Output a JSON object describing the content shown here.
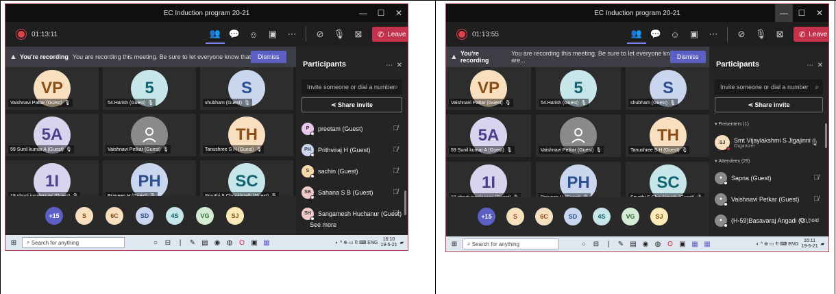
{
  "left": {
    "window_title": "EC Induction program 20-21",
    "timer": "01:13:11",
    "leave_label": "Leave",
    "banner": {
      "bold": "You're recording",
      "text": "You are recording this meeting. Be sure to let everyone know that they are...",
      "dismiss": "Dismiss"
    },
    "tiles": [
      {
        "initials": "VP",
        "name": "Vaishnavi Pattar (Guest)",
        "bg": "#f7dfc0",
        "fg": "#8a4f16"
      },
      {
        "initials": "5",
        "name": "54.Harish (Guest)",
        "bg": "#c7e6ea",
        "fg": "#12646f"
      },
      {
        "initials": "S",
        "name": "shubham (Guest)",
        "bg": "#c9d6ee",
        "fg": "#2b4f8f"
      },
      {
        "initials": "5A",
        "name": "59 Sunil kumar A (Guest)",
        "bg": "#d8d4ee",
        "fg": "#4a3f8a"
      },
      {
        "initials": "",
        "name": "Vaishnavi Petkar (Guest)",
        "bg": "#8a8a8a",
        "fg": "#ffffff"
      },
      {
        "initials": "TH",
        "name": "Tanushree S H (Guest)",
        "bg": "#f7dfc0",
        "fg": "#8a4f16"
      },
      {
        "initials": "1I",
        "name": "19 shruti ingaleswar (Guest)",
        "bg": "#d8d4ee",
        "fg": "#4a3f8a"
      },
      {
        "initials": "PH",
        "name": "Praveen H (Guest)",
        "bg": "#c9d6ee",
        "fg": "#2b4f8f"
      },
      {
        "initials": "SC",
        "name": "Spurthi S Choukimath (Guest)",
        "bg": "#c7e6ea",
        "fg": "#12646f"
      }
    ],
    "bottom_avatars": [
      {
        "label": "+15",
        "bg": "#5c5fc4",
        "fg": "#ffffff"
      },
      {
        "label": "S",
        "bg": "#f7dfc0",
        "fg": "#8a4f16"
      },
      {
        "label": "6C",
        "bg": "#f7dfc0",
        "fg": "#8a4f16"
      },
      {
        "label": "SD",
        "bg": "#c9d6ee",
        "fg": "#2b4f8f"
      },
      {
        "label": "4S",
        "bg": "#c7e6ea",
        "fg": "#12646f"
      },
      {
        "label": "VG",
        "bg": "#d4ecd4",
        "fg": "#2f6b2f"
      },
      {
        "label": "SJ",
        "bg": "#fbe9b8",
        "fg": "#7a5a10"
      }
    ],
    "panel": {
      "title": "Participants",
      "invite_placeholder": "Invite someone or dial a number",
      "share": "Share invite",
      "people": [
        {
          "initials": "P",
          "name": "preetam (Guest)",
          "bg": "#e8c8e8"
        },
        {
          "initials": "PH",
          "name": "Prithviraj H (Guest)",
          "bg": "#c9d6ee"
        },
        {
          "initials": "S",
          "name": "sachin (Guest)",
          "bg": "#f7d8a8"
        },
        {
          "initials": "SB",
          "name": "Sahana S B (Guest)",
          "bg": "#f0c8c8"
        },
        {
          "initials": "SH",
          "name": "Sangamesh Huchanur (Guest)",
          "bg": "#f0c8c8"
        }
      ],
      "see_more": "See more"
    },
    "taskbar": {
      "search": "Search for anything",
      "lang": "ENG",
      "time": "16:10",
      "date": "19-5-21"
    }
  },
  "right": {
    "window_title": "EC Induction program 20-21",
    "timer": "01:13:55",
    "leave_label": "Leave",
    "banner": {
      "bold": "You're recording",
      "text": "You are recording this meeting. Be sure to let everyone know that they are...",
      "dismiss": "Dismiss"
    },
    "tiles": [
      {
        "initials": "VP",
        "name": "Vaishnavi Pattar (Guest)",
        "bg": "#f7dfc0",
        "fg": "#8a4f16"
      },
      {
        "initials": "5",
        "name": "54.Harish (Guest)",
        "bg": "#c7e6ea",
        "fg": "#12646f"
      },
      {
        "initials": "S",
        "name": "shubham (Guest)",
        "bg": "#c9d6ee",
        "fg": "#2b4f8f"
      },
      {
        "initials": "5A",
        "name": "59 Sunil kumar A (Guest)",
        "bg": "#d8d4ee",
        "fg": "#4a3f8a"
      },
      {
        "initials": "",
        "name": "Vaishnavi Petkar (Guest)",
        "bg": "#8a8a8a",
        "fg": "#ffffff"
      },
      {
        "initials": "TH",
        "name": "Tanushree S H (Guest)",
        "bg": "#f7dfc0",
        "fg": "#8a4f16"
      },
      {
        "initials": "1I",
        "name": "19 shruti ingaleswar (Guest)",
        "bg": "#d8d4ee",
        "fg": "#4a3f8a"
      },
      {
        "initials": "PH",
        "name": "Praveen H (Guest)",
        "bg": "#c9d6ee",
        "fg": "#2b4f8f"
      },
      {
        "initials": "SC",
        "name": "Spurthi S Choukimath (Guest)",
        "bg": "#c7e6ea",
        "fg": "#12646f"
      }
    ],
    "bottom_avatars": [
      {
        "label": "+15",
        "bg": "#5c5fc4",
        "fg": "#ffffff"
      },
      {
        "label": "S",
        "bg": "#f7dfc0",
        "fg": "#8a4f16"
      },
      {
        "label": "6C",
        "bg": "#f7dfc0",
        "fg": "#8a4f16"
      },
      {
        "label": "SD",
        "bg": "#c9d6ee",
        "fg": "#2b4f8f"
      },
      {
        "label": "4S",
        "bg": "#c7e6ea",
        "fg": "#12646f"
      },
      {
        "label": "VG",
        "bg": "#d4ecd4",
        "fg": "#2f6b2f"
      },
      {
        "label": "SJ",
        "bg": "#fbe9b8",
        "fg": "#7a5a10"
      }
    ],
    "panel": {
      "title": "Participants",
      "invite_placeholder": "Invite someone or dial a number",
      "share": "Share invite",
      "presenters_header": "Presenters (1)",
      "presenter": {
        "initials": "SJ",
        "name": "Smt Vijaylakshmi S Jigajinni",
        "role": "Organizer",
        "bg": "#f7dfc0"
      },
      "attendees_header": "Attendees (29)",
      "attendees": [
        {
          "name": "Sapna (Guest)",
          "status": ""
        },
        {
          "name": "Vaishnavi Petkar (Guest)",
          "status": ""
        },
        {
          "name": "(H-59)Basavaraj Angadi (G...",
          "status": "On hold"
        }
      ]
    },
    "taskbar": {
      "search": "Search for anything",
      "lang": "ENG",
      "time": "16:11",
      "date": "19-5-21"
    }
  }
}
